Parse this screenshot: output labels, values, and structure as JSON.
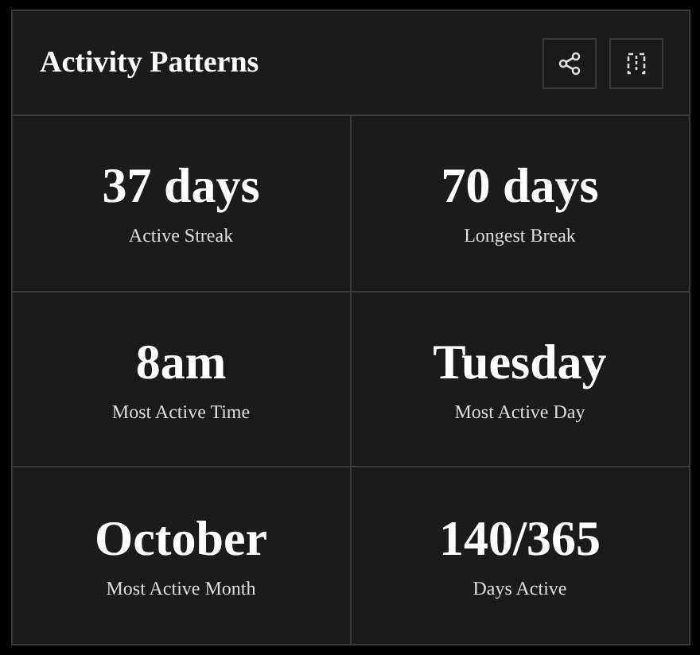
{
  "card": {
    "title": "Activity Patterns"
  },
  "stats": [
    {
      "value": "37 days",
      "label": "Active Streak"
    },
    {
      "value": "70 days",
      "label": "Longest Break"
    },
    {
      "value": "8am",
      "label": "Most Active Time"
    },
    {
      "value": "Tuesday",
      "label": "Most Active Day"
    },
    {
      "value": "October",
      "label": "Most Active Month"
    },
    {
      "value": "140/365",
      "label": "Days Active"
    }
  ]
}
